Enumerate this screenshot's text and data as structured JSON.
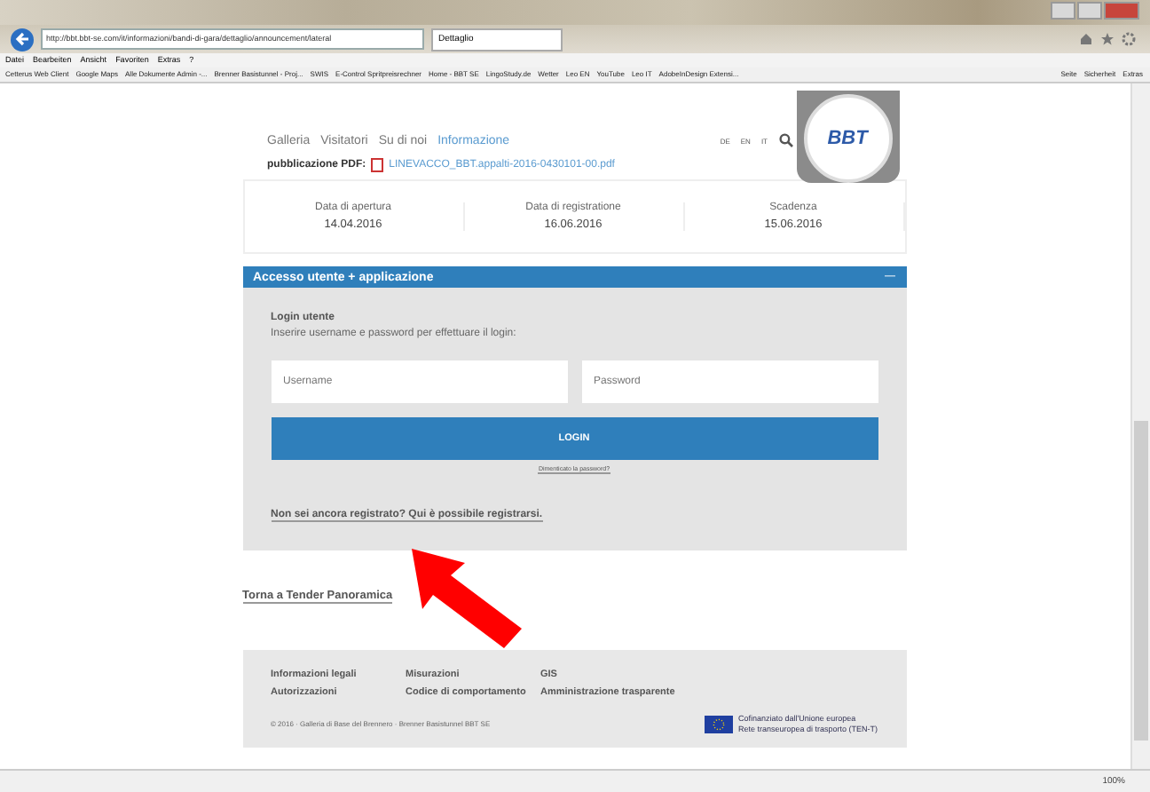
{
  "browser": {
    "address": "http://bbt.bbt-se.com/it/informazioni/bandi-di-gara/dettaglio/announcement/lateral",
    "tab": "Dettaglio",
    "menu": [
      "Datei",
      "Bearbeiten",
      "Ansicht",
      "Favoriten",
      "Extras",
      "?"
    ],
    "favorites": [
      "Cetterus Web Client",
      "Google Maps",
      "Alle Dokumente Admin -...",
      "Brenner Basistunnel - Proj...",
      "SWIS",
      "E-Control Spritpreisrechner",
      "Home - BBT SE",
      "LingoStudy.de",
      "Wetter",
      "Leo EN",
      "YouTube",
      "Leo IT",
      "AdobeInDesign Extensi..."
    ],
    "tools": [
      "Seite",
      "Sicherheit",
      "Extras"
    ],
    "zoom": "100%"
  },
  "nav": {
    "items": [
      {
        "label": "Galleria",
        "selected": false
      },
      {
        "label": "Visitatori",
        "selected": false
      },
      {
        "label": "Su di noi",
        "selected": false
      },
      {
        "label": "Informazione",
        "selected": true
      }
    ],
    "languages": [
      "DE",
      "EN",
      "IT"
    ],
    "logo": "BBT"
  },
  "publication": {
    "label": "pubblicazione PDF:",
    "file": "LINEVACCO_BBT.appalti-2016-0430101-00.pdf"
  },
  "dates": [
    {
      "label": "Data di apertura",
      "value": "14.04.2016"
    },
    {
      "label": "Data di registratione",
      "value": "16.06.2016"
    },
    {
      "label": "Scadenza",
      "value": "15.06.2016"
    }
  ],
  "panel": {
    "title": "Accesso utente + applicazione",
    "toggle": "—",
    "expanded": true,
    "heading": "Login utente",
    "intro": "Inserire username e password per effettuare il login:",
    "username_placeholder": "Username",
    "password_placeholder": "Password",
    "login": "LOGIN",
    "forgot": "Dimenticato la password?",
    "register": "Non sei ancora registrato? Qui è possibile registrarsi."
  },
  "back_link": "Torna a Tender Panoramica",
  "footer": {
    "links": [
      [
        "Informazioni legali",
        "Autorizzazioni"
      ],
      [
        "Misurazioni",
        "Codice di comportamento"
      ],
      [
        "GIS",
        "Amministrazione trasparente"
      ]
    ],
    "copyright": "© 2016 · Galleria di Base del Brennero · Brenner Basistunnel BBT SE",
    "eu": [
      "Cofinanziato dall'Unione europea",
      "Rete transeuropea di trasporto (TEN-T)"
    ]
  }
}
